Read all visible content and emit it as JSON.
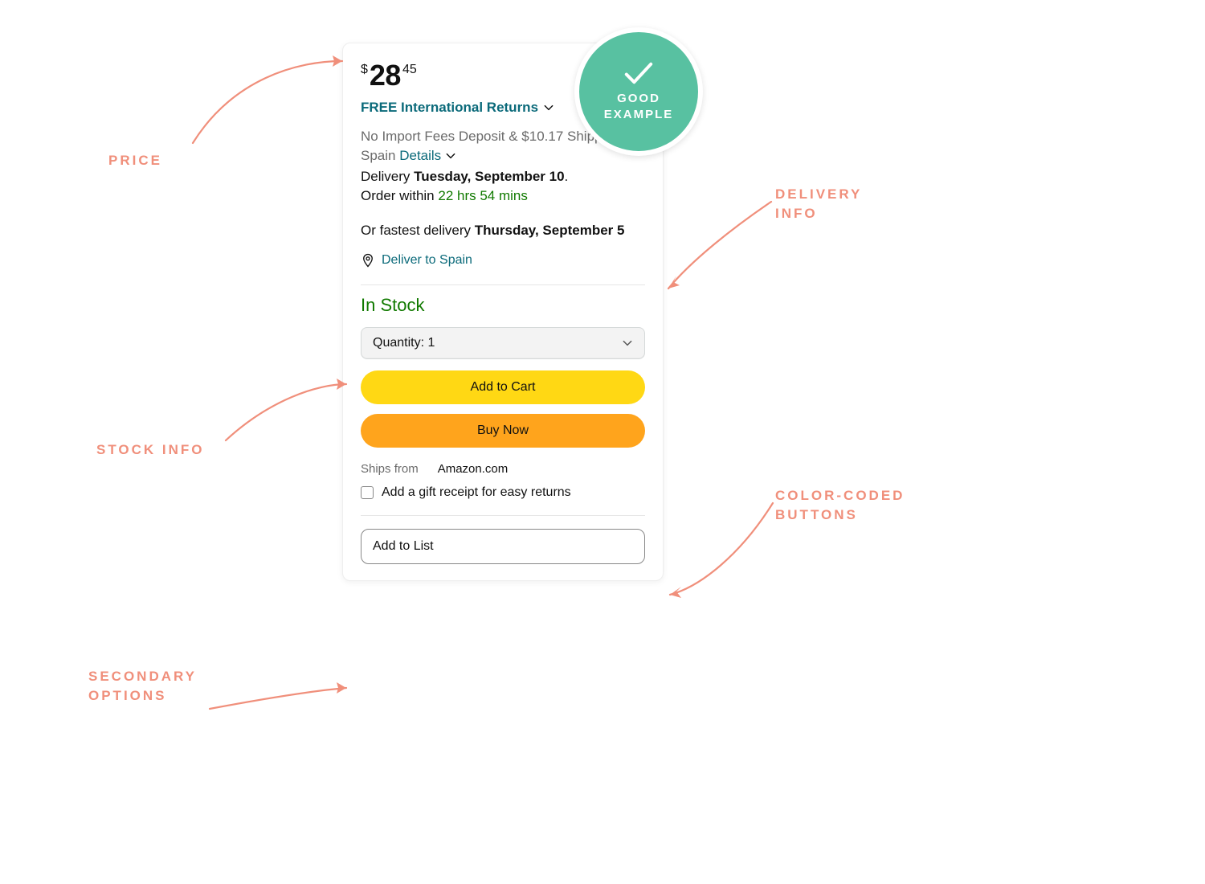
{
  "badge": {
    "line1": "GOOD",
    "line2": "EXAMPLE"
  },
  "annotations": {
    "price": "PRICE",
    "stock": "STOCK INFO",
    "secondary": "SECONDARY\nOPTIONS",
    "delivery": "DELIVERY\nINFO",
    "buttons": "COLOR-CODED\nBUTTONS"
  },
  "price": {
    "currency": "$",
    "whole": "28",
    "cents": "45"
  },
  "returns": {
    "label": "FREE International Returns"
  },
  "fees": {
    "prefix": "No Import Fees Deposit & $10.17 Shipping to Spain",
    "details": "Details"
  },
  "delivery": {
    "label": "Delivery",
    "date": "Tuesday, September 10",
    "order_prefix": "Order within",
    "countdown": "22 hrs 54 mins"
  },
  "fastest": {
    "prefix": "Or fastest delivery",
    "date": "Thursday, September 5"
  },
  "deliver_to": {
    "label": "Deliver to Spain"
  },
  "stock": {
    "label": "In Stock"
  },
  "quantity": {
    "label": "Quantity:",
    "value": "1"
  },
  "buttons": {
    "add_to_cart": "Add to Cart",
    "buy_now": "Buy Now",
    "add_to_list": "Add to List"
  },
  "ships": {
    "label": "Ships from",
    "value": "Amazon.com"
  },
  "gift": {
    "label": "Add a gift receipt for easy returns"
  }
}
